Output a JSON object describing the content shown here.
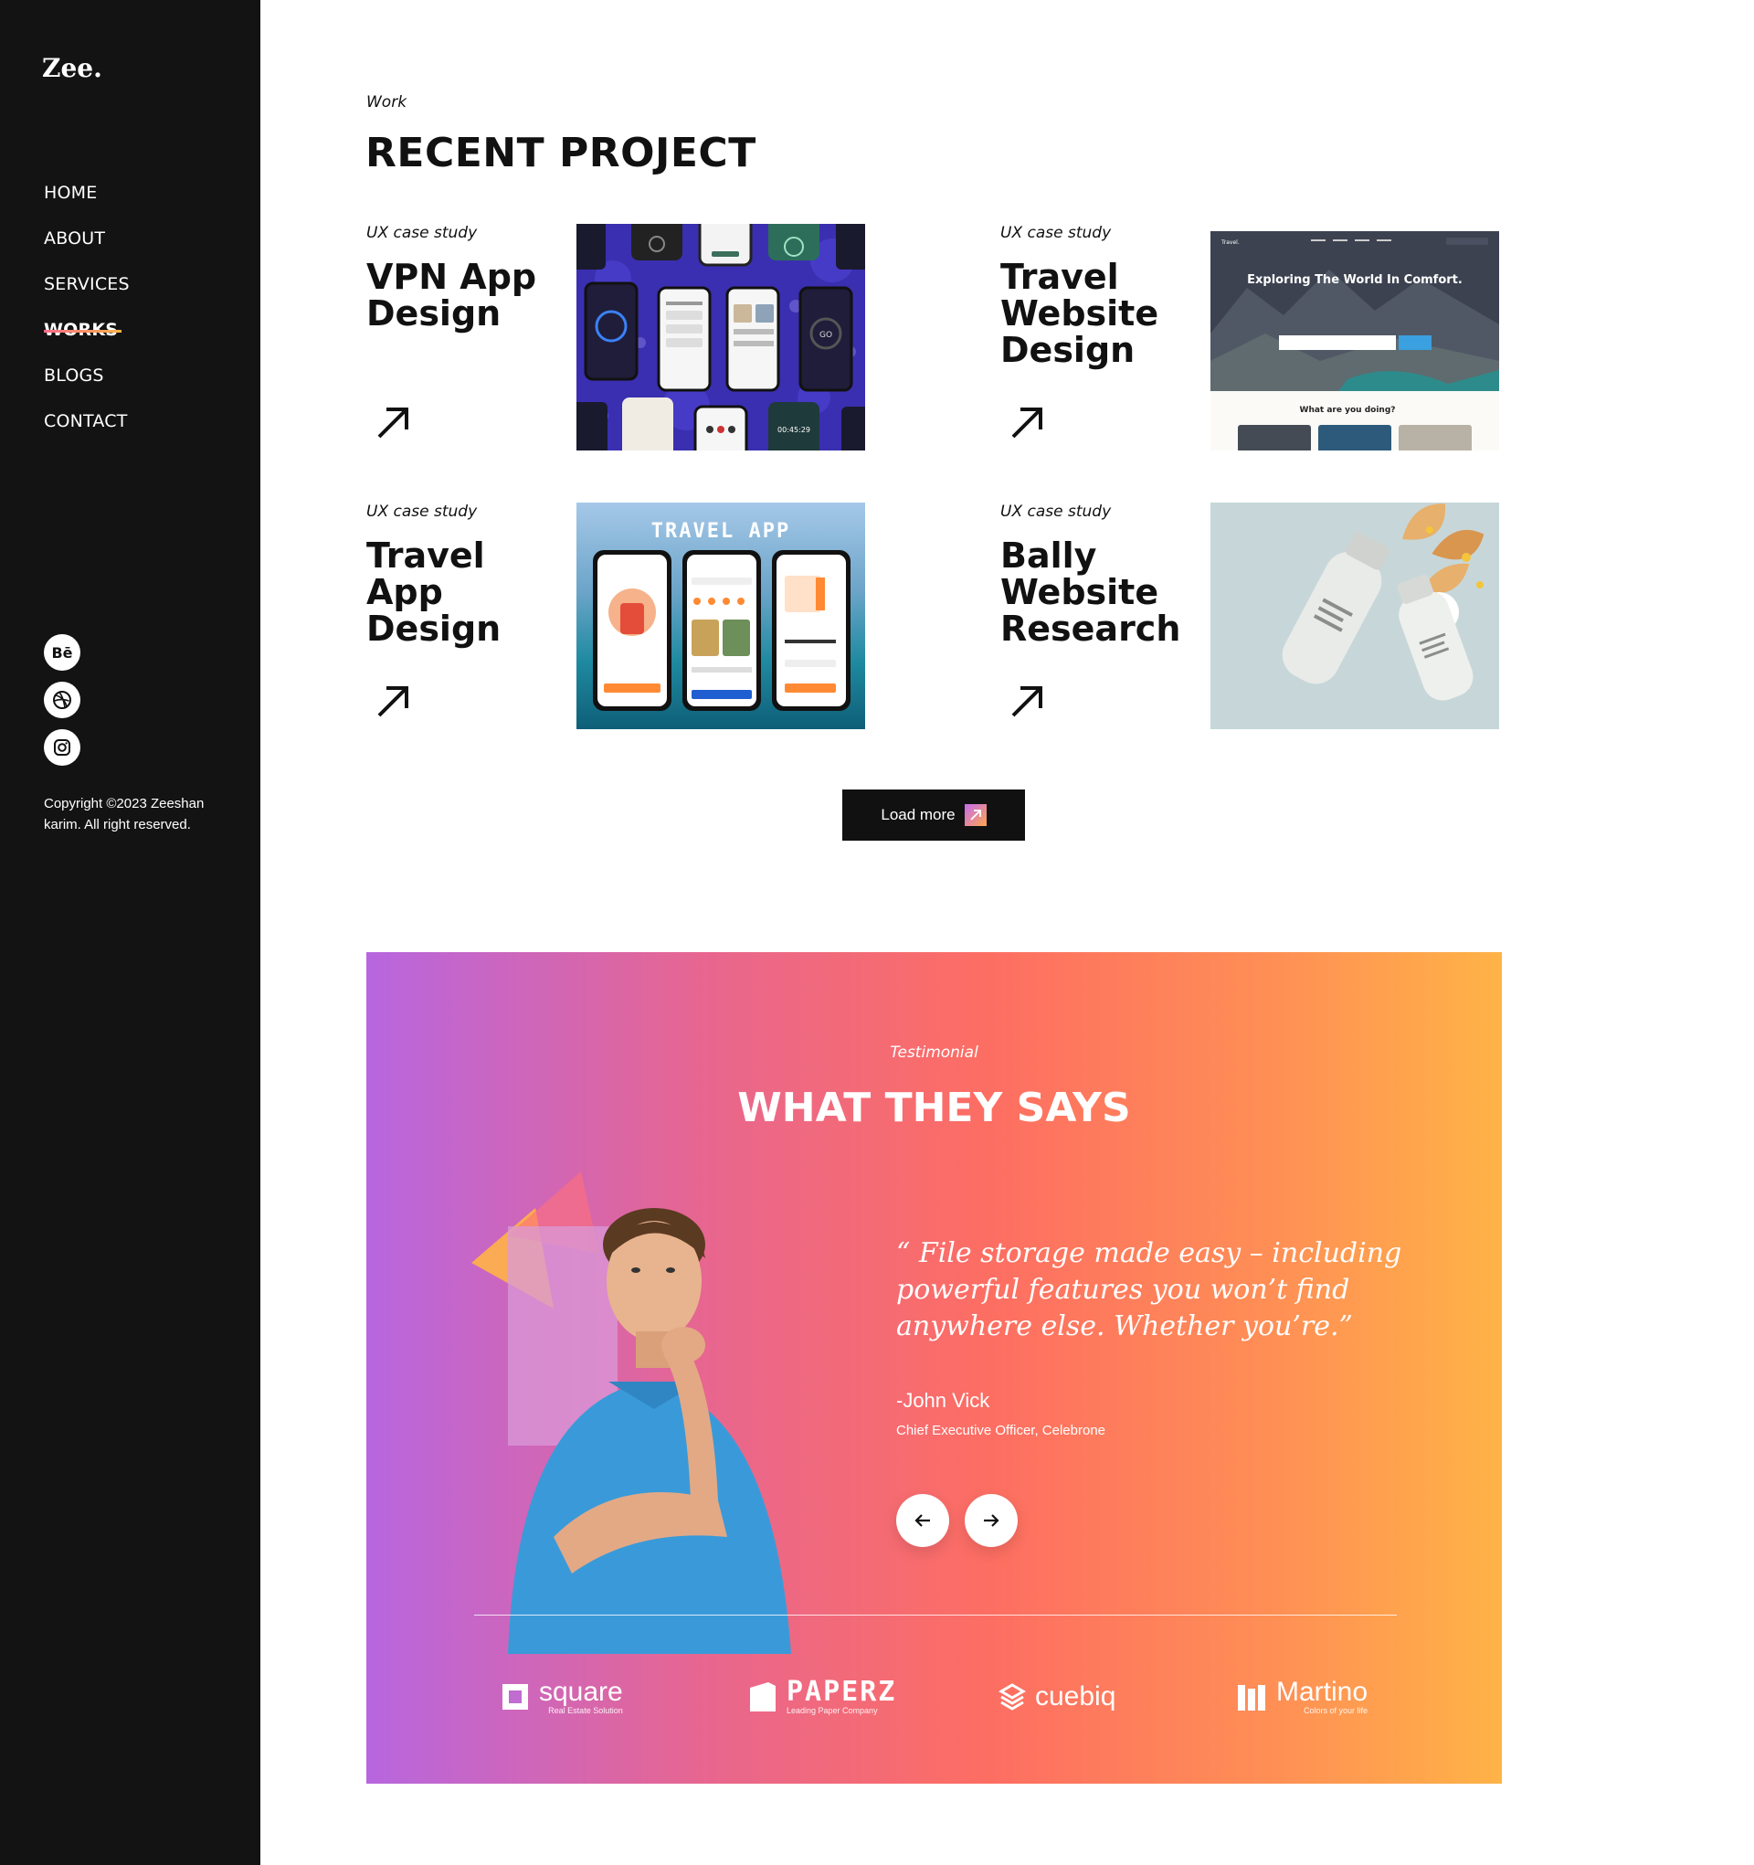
{
  "sidebar": {
    "logo": "Zee.",
    "nav": [
      {
        "label": "HOME"
      },
      {
        "label": "ABOUT"
      },
      {
        "label": "SERVICES"
      },
      {
        "label": "WORKS",
        "active": true
      },
      {
        "label": "BLOGS"
      },
      {
        "label": "CONTACT"
      }
    ],
    "socials": [
      {
        "icon": "behance-icon",
        "text": "Bē"
      },
      {
        "icon": "dribbble-icon"
      },
      {
        "icon": "instagram-icon"
      }
    ],
    "copyright": "Copyright ©2023 Zeeshan karim. All right reserved."
  },
  "work": {
    "eyebrow": "Work",
    "heading": "RECENT PROJECT",
    "projects": [
      {
        "kicker": "UX case study",
        "title": "VPN App Design",
        "thumb": "vpn-app-mockups"
      },
      {
        "kicker": "UX case study",
        "title": "Travel Website Design",
        "thumb": "travel-website-mockup",
        "thumb_headline": "Exploring The World In Comfort.",
        "thumb_sub": "What are you doing?",
        "thumb_logo": "Travel."
      },
      {
        "kicker": "UX case study",
        "title": "Travel App Design",
        "thumb": "travel-app-mockups",
        "thumb_headline": "TRAVEL APP"
      },
      {
        "kicker": "UX case study",
        "title": "Bally Website Research",
        "thumb": "bottle-product-photo"
      }
    ],
    "load_more": "Load more"
  },
  "testimonial": {
    "eyebrow": "Testimonial",
    "heading": "WHAT THEY SAYS",
    "quote": "“ File storage made easy – including powerful features you won’t find anywhere else. Whether you’re.”",
    "author": "-John Vick",
    "role": "Chief Executive Officer, Celebrone",
    "brands": [
      {
        "name": "square",
        "tagline": "Real Estate Solution"
      },
      {
        "name": "PAPERZ",
        "tagline": "Leading Paper Company"
      },
      {
        "name": "cuebiq",
        "tagline": ""
      },
      {
        "name": "Martino",
        "tagline": "Colors of your life"
      }
    ]
  },
  "colors": {
    "sidebar_bg": "#131313",
    "gradient_start": "#b766e0",
    "gradient_mid": "#fd6e62",
    "gradient_end": "#ffb347"
  }
}
